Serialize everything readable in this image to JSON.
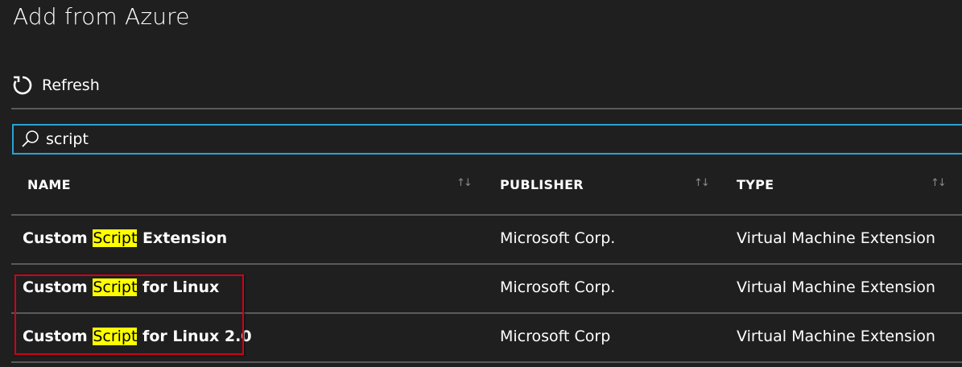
{
  "app": {
    "title": "Add from Azure"
  },
  "toolbar": {
    "refresh_label": "Refresh",
    "refresh_icon": "refresh-icon"
  },
  "search": {
    "icon": "search-icon",
    "value": "script"
  },
  "table": {
    "columns": [
      {
        "label": "NAME",
        "sort_icon": "↑↓"
      },
      {
        "label": "PUBLISHER",
        "sort_icon": "↑↓"
      },
      {
        "label": "TYPE",
        "sort_icon": "↑↓"
      }
    ],
    "rows": [
      {
        "name_prefix": "Custom ",
        "name_match": "Script",
        "name_suffix": " Extension",
        "publisher": "Microsoft Corp.",
        "type": "Virtual Machine Extension"
      },
      {
        "name_prefix": "Custom ",
        "name_match": "Script",
        "name_suffix": " for Linux",
        "publisher": "Microsoft Corp.",
        "type": "Virtual Machine Extension"
      },
      {
        "name_prefix": "Custom ",
        "name_match": "Script",
        "name_suffix": " for Linux 2.0",
        "publisher": "Microsoft Corp",
        "type": "Virtual Machine Extension"
      }
    ]
  },
  "colors": {
    "background": "#1f1f1f",
    "accent": "#2aa1d9",
    "highlight": "#ffff00",
    "annotation": "#d0021b"
  }
}
